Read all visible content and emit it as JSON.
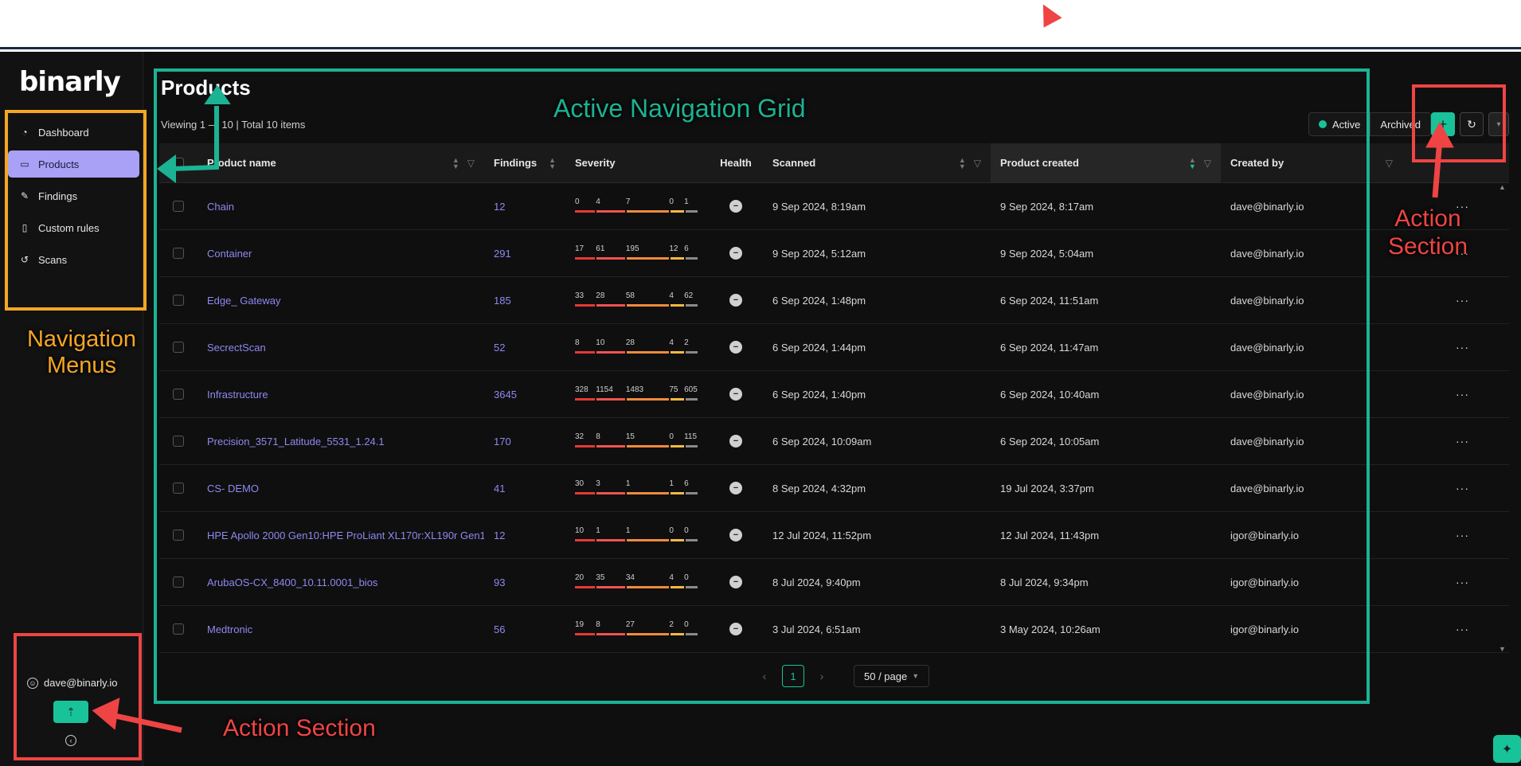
{
  "brand": {
    "logo": "binarly"
  },
  "sidebar": {
    "items": [
      {
        "label": "Dashboard",
        "icon": "pie-chart-icon",
        "active": false
      },
      {
        "label": "Products",
        "icon": "folder-icon",
        "active": true
      },
      {
        "label": "Findings",
        "icon": "bug-icon",
        "active": false
      },
      {
        "label": "Custom rules",
        "icon": "rules-icon",
        "active": false
      },
      {
        "label": "Scans",
        "icon": "history-icon",
        "active": false
      }
    ],
    "user_email": "dave@binarly.io"
  },
  "main": {
    "title": "Products",
    "viewing_text": "Viewing 1 — 10 | Total 10 items",
    "segment": {
      "active": "Active",
      "archived": "Archived"
    },
    "columns": [
      "Product name",
      "Findings",
      "Severity",
      "Health",
      "Scanned",
      "Product created",
      "Created by"
    ],
    "rows": [
      {
        "name": "Chain",
        "findings": "12",
        "sev": [
          "0",
          "4",
          "7",
          "0",
          "1"
        ],
        "scanned": "9 Sep 2024, 8:19am",
        "created": "9 Sep 2024, 8:17am",
        "by": "dave@binarly.io"
      },
      {
        "name": "Container",
        "findings": "291",
        "sev": [
          "17",
          "61",
          "195",
          "12",
          "6"
        ],
        "scanned": "9 Sep 2024, 5:12am",
        "created": "9 Sep 2024, 5:04am",
        "by": "dave@binarly.io"
      },
      {
        "name": "Edge_ Gateway",
        "findings": "185",
        "sev": [
          "33",
          "28",
          "58",
          "4",
          "62"
        ],
        "scanned": "6 Sep 2024, 1:48pm",
        "created": "6 Sep 2024, 11:51am",
        "by": "dave@binarly.io"
      },
      {
        "name": "SecrectScan",
        "findings": "52",
        "sev": [
          "8",
          "10",
          "28",
          "4",
          "2"
        ],
        "scanned": "6 Sep 2024, 1:44pm",
        "created": "6 Sep 2024, 11:47am",
        "by": "dave@binarly.io"
      },
      {
        "name": "Infrastructure",
        "findings": "3645",
        "sev": [
          "328",
          "1154",
          "1483",
          "75",
          "605"
        ],
        "scanned": "6 Sep 2024, 1:40pm",
        "created": "6 Sep 2024, 10:40am",
        "by": "dave@binarly.io"
      },
      {
        "name": "Precision_3571_Latitude_5531_1.24.1",
        "findings": "170",
        "sev": [
          "32",
          "8",
          "15",
          "0",
          "115"
        ],
        "scanned": "6 Sep 2024, 10:09am",
        "created": "6 Sep 2024, 10:05am",
        "by": "dave@binarly.io"
      },
      {
        "name": "CS- DEMO",
        "findings": "41",
        "sev": [
          "30",
          "3",
          "1",
          "1",
          "6"
        ],
        "scanned": "8 Sep 2024, 4:32pm",
        "created": "19 Jul 2024, 3:37pm",
        "by": "dave@binarly.io"
      },
      {
        "name": "HPE Apollo 2000 Gen10:HPE ProLiant XL170r:XL190r Gen1...",
        "findings": "12",
        "sev": [
          "10",
          "1",
          "1",
          "0",
          "0"
        ],
        "scanned": "12 Jul 2024, 11:52pm",
        "created": "12 Jul 2024, 11:43pm",
        "by": "igor@binarly.io"
      },
      {
        "name": "ArubaOS-CX_8400_10.11.0001_bios",
        "findings": "93",
        "sev": [
          "20",
          "35",
          "34",
          "4",
          "0"
        ],
        "scanned": "8 Jul 2024, 9:40pm",
        "created": "8 Jul 2024, 9:34pm",
        "by": "igor@binarly.io"
      },
      {
        "name": "Medtronic",
        "findings": "56",
        "sev": [
          "19",
          "8",
          "27",
          "2",
          "0"
        ],
        "scanned": "3 Jul 2024, 6:51am",
        "created": "3 May 2024, 10:26am",
        "by": "igor@binarly.io"
      }
    ],
    "pagination": {
      "current": "1",
      "page_size": "50 / page"
    }
  },
  "severity_colors": [
    "#e53935",
    "#ef5350",
    "#f08a3c",
    "#f5b942",
    "#8a8a8a"
  ],
  "annotations": {
    "nav": "Navigation\nMenus",
    "grid": "Active Navigation Grid",
    "action_bottom": "Action Section",
    "action_top": "Action\nSection"
  }
}
